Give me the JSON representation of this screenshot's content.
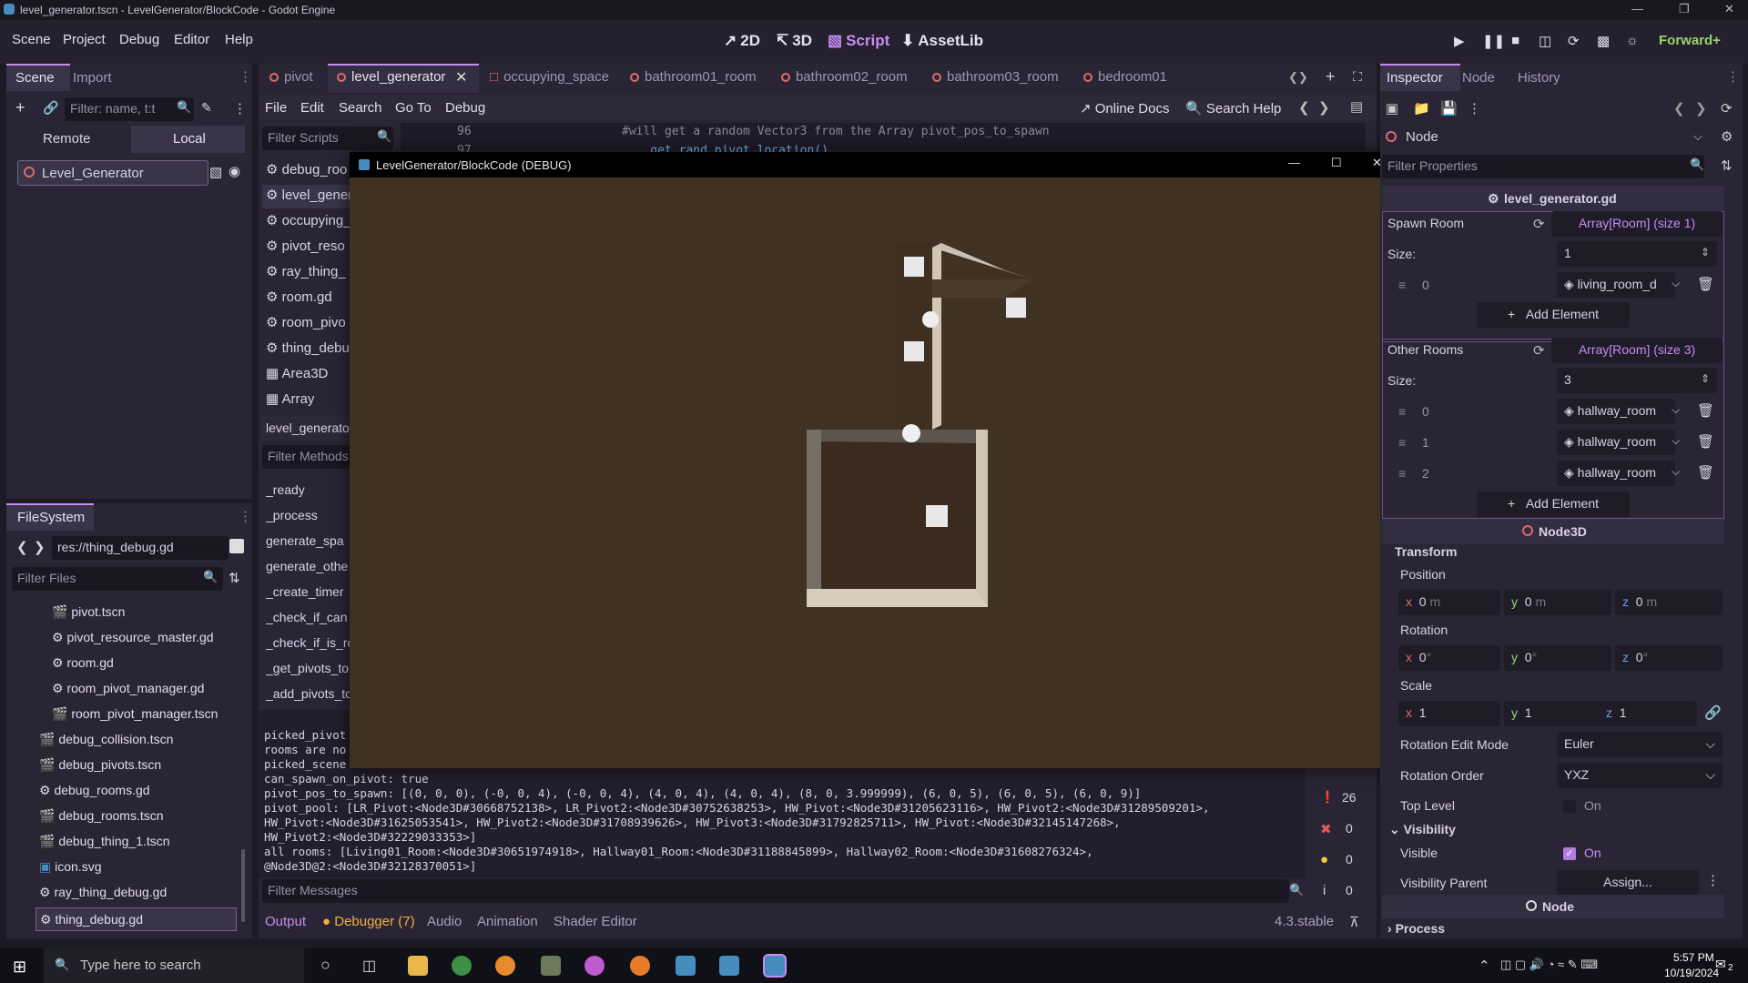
{
  "window": {
    "title": "level_generator.tscn - LevelGenerator/BlockCode - Godot Engine"
  },
  "menu": {
    "items": [
      "Scene",
      "Project",
      "Debug",
      "Editor",
      "Help"
    ]
  },
  "workspaces": [
    {
      "label": "2D",
      "icon": "2d-icon"
    },
    {
      "label": "3D",
      "icon": "3d-icon"
    },
    {
      "label": "Script",
      "icon": "script-icon"
    },
    {
      "label": "AssetLib",
      "icon": "assetlib-icon"
    }
  ],
  "renderer": "Forward+",
  "scene_dock": {
    "tabs": [
      "Scene",
      "Import"
    ],
    "filter_placeholder": "Filter: name, t:t",
    "remote": "Remote",
    "local": "Local",
    "root_node": "Level_Generator"
  },
  "filesystem": {
    "tab": "FileSystem",
    "path": "res://thing_debug.gd",
    "filter_placeholder": "Filter Files",
    "items": [
      "pivot.tscn",
      "pivot_resource_master.gd",
      "room.gd",
      "room_pivot_manager.gd",
      "room_pivot_manager.tscn",
      "debug_collision.tscn",
      "debug_pivots.tscn",
      "debug_rooms.gd",
      "debug_rooms.tscn",
      "debug_thing_1.tscn",
      "icon.svg",
      "ray_thing_debug.gd",
      "thing_debug.gd"
    ]
  },
  "editor_tabs": [
    "pivot",
    "level_generator",
    "occupying_space",
    "bathroom01_room",
    "bathroom02_room",
    "bathroom03_room",
    "bedroom01"
  ],
  "script_menu": {
    "items": [
      "File",
      "Edit",
      "Search",
      "Go To",
      "Debug"
    ],
    "online_docs": "Online Docs",
    "search_help": "Search Help"
  },
  "scripts": {
    "filter_placeholder": "Filter Scripts",
    "items": [
      "debug_roo",
      "level_gener",
      "occupying_",
      "pivot_reso",
      "ray_thing_",
      "room.gd",
      "room_pivo",
      "thing_debu",
      "Area3D",
      "Array"
    ],
    "current": "level_generato"
  },
  "methods": {
    "filter_placeholder": "Filter Methods",
    "items": [
      "_ready",
      "_process",
      "generate_spa",
      "generate_othe",
      "_create_timer",
      "_check_if_can",
      "_check_if_is_ro",
      "_get_pivots_to",
      "_add_pivots_to"
    ]
  },
  "code": {
    "line1_no": "96",
    "line1": "#will get a random Vector3 from the Array pivot_pos_to_spawn",
    "line2_no": "97",
    "line2": "    get_rand_pivot_location()"
  },
  "game_window": {
    "title": "LevelGenerator/BlockCode (DEBUG)"
  },
  "console": {
    "lines": [
      "picked_pivot",
      "rooms are no",
      "picked_scene",
      "can_spawn_on_pivot: true",
      "pivot_pos_to_spawn: [(0, 0, 0), (-0, 0, 4), (-0, 0, 4), (4, 0, 4), (4, 0, 4), (8, 0, 3.999999), (6, 0, 5), (6, 0, 5), (6, 0, 9)]",
      "pivot_pool: [LR_Pivot:<Node3D#30668752138>, LR_Pivot2:<Node3D#30752638253>, HW_Pivot:<Node3D#31205623116>, HW_Pivot2:<Node3D#31289509201>,",
      "HW_Pivot:<Node3D#31625053541>, HW_Pivot2:<Node3D#31708939626>, HW_Pivot3:<Node3D#31792825711>, HW_Pivot:<Node3D#32145147268>,",
      "HW_Pivot2:<Node3D#32229033353>]",
      "all rooms: [Living01_Room:<Node3D#30651974918>, Hallway01_Room:<Node3D#31188845899>, Hallway02_Room:<Node3D#31608276324>,",
      "@Node3D@2:<Node3D#32128370051>]"
    ],
    "filter_placeholder": "Filter Messages",
    "counts": {
      "messages": "26",
      "errors": "0",
      "warnings": "0",
      "info": "0"
    }
  },
  "bottom_tabs": [
    "Output",
    "Debugger (7)",
    "Audio",
    "Animation",
    "Shader Editor"
  ],
  "version": "4.3.stable",
  "inspector": {
    "tabs": [
      "Inspector",
      "Node",
      "History"
    ],
    "node": "Node",
    "filter_placeholder": "Filter Properties",
    "script": "level_generator.gd",
    "spawn_room": {
      "label": "Spawn Room",
      "type": "Array[Room] (size 1)",
      "size_label": "Size:",
      "size": "1",
      "items": [
        {
          "index": "0",
          "value": "living_room_d"
        }
      ],
      "add": "Add Element"
    },
    "other_rooms": {
      "label": "Other Rooms",
      "type": "Array[Room] (size 3)",
      "size_label": "Size:",
      "size": "3",
      "items": [
        {
          "index": "0",
          "value": "hallway_room"
        },
        {
          "index": "1",
          "value": "hallway_room"
        },
        {
          "index": "2",
          "value": "hallway_room"
        }
      ],
      "add": "Add Element"
    },
    "node3d": "Node3D",
    "transform": "Transform",
    "position": "Position",
    "pos": {
      "x": "0",
      "y": "0",
      "z": "0",
      "unit": "m"
    },
    "rotation": "Rotation",
    "rot": {
      "x": "0",
      "y": "0",
      "z": "0",
      "unit": "°"
    },
    "scale": "Scale",
    "scl": {
      "x": "1",
      "y": "1",
      "z": "1"
    },
    "rot_edit_mode_label": "Rotation Edit Mode",
    "rot_edit_mode": "Euler",
    "rot_order_label": "Rotation Order",
    "rot_order": "YXZ",
    "top_level_label": "Top Level",
    "top_level": "On",
    "visibility": "Visibility",
    "visible_label": "Visible",
    "visible": "On",
    "vis_parent_label": "Visibility Parent",
    "vis_parent": "Assign...",
    "process": "Process"
  },
  "taskbar": {
    "search_placeholder": "Type here to search",
    "time": "5:57 PM",
    "date": "10/19/2024",
    "notif": "2"
  }
}
